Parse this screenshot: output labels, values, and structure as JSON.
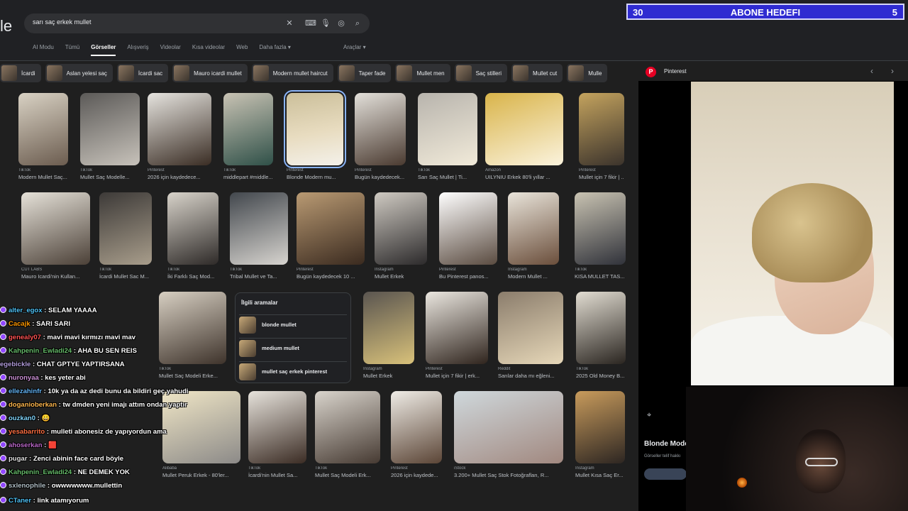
{
  "search": {
    "logo_fragment": "le",
    "query": "sarı saç erkek mullet",
    "tabs": [
      "AI Modu",
      "Tümü",
      "Görseller",
      "Alışveriş",
      "Videolar",
      "Kısa videolar",
      "Web",
      "Daha fazla ▾"
    ],
    "active_tab": "Görseller",
    "tools_label": "Araçlar ▾"
  },
  "goal": {
    "left": "30",
    "title": "ABONE HEDEFI",
    "right": "5"
  },
  "chips": [
    "İcardi",
    "Aslan yelesi saç",
    "İcardi sac",
    "Mauro icardi mullet",
    "Modern mullet haircut",
    "Taper fade",
    "Mullet men",
    "Saç stilleri",
    "Mullet cut",
    "Mulle"
  ],
  "grid": [
    {
      "src": "TikTok",
      "cap": "Modern Mullet Saç..."
    },
    {
      "src": "TikTok",
      "cap": "Mullet Saç Modelle..."
    },
    {
      "src": "Pinterest",
      "cap": "2026 için kaydedece..."
    },
    {
      "src": "TikTok",
      "cap": "middlepart #middle..."
    },
    {
      "src": "Pinterest",
      "cap": "Blonde Modern mu..."
    },
    {
      "src": "Pinterest",
      "cap": "Bugün kaydedecek..."
    },
    {
      "src": "TikTok",
      "cap": "Sarı Saç Mullet | Ti..."
    },
    {
      "src": "Amazon",
      "cap": "UILYNIU Erkek 80'li yıllar ..."
    },
    {
      "src": "Pinterest",
      "cap": "Mullet için 7 fikir | ..."
    },
    {
      "src": "CUT LABS",
      "cap": "Mauro Icardi'nin Kullan..."
    },
    {
      "src": "TikTok",
      "cap": "İcardi Mullet Sac M..."
    },
    {
      "src": "TikTok",
      "cap": "İki Farklı Saç Mod..."
    },
    {
      "src": "TikTok",
      "cap": "Tribal Mullet ve Ta..."
    },
    {
      "src": "Pinterest",
      "cap": "Bugün kaydedecek 10 ..."
    },
    {
      "src": "Instagram",
      "cap": "Mullet Erkek"
    },
    {
      "src": "Pinterest",
      "cap": "Bu Pinterest panos..."
    },
    {
      "src": "Instagram",
      "cap": "Modern Mullet ..."
    },
    {
      "src": "TikTok",
      "cap": "KISA MULLET TAS..."
    },
    {
      "src": "TikTok",
      "cap": "Mullet Saç Modeli Erke..."
    },
    {
      "src": "Instagram",
      "cap": "Mullet Erkek"
    },
    {
      "src": "Pinterest",
      "cap": "Mullet için 7 fikir | erk..."
    },
    {
      "src": "Reddit",
      "cap": "Sarılar daha mı eğleni..."
    },
    {
      "src": "TikTok",
      "cap": "2025 Old Money B..."
    },
    {
      "src": "Alibaba",
      "cap": "Mullet Peruk Erkek - 80'ler..."
    },
    {
      "src": "TikTok",
      "cap": "İcardi'nin Mullet Sa..."
    },
    {
      "src": "TikTok",
      "cap": "Mullet Saç Modeli Erk..."
    },
    {
      "src": "Pinterest",
      "cap": "2026 için kaydede..."
    },
    {
      "src": "iStock",
      "cap": "3.200+ Mullet Saç Stok Fotoğrafları, R..."
    },
    {
      "src": "Instagram",
      "cap": "Mullet Kısa Saç Er..."
    }
  ],
  "related": {
    "title": "İlgili aramalar",
    "items": [
      "blonde mullet",
      "medium mullet",
      "mullet saç erkek pinterest"
    ]
  },
  "panel": {
    "source": "Pinterest",
    "title": "Blonde Mode",
    "subtitle": "Görseller telif hakkı"
  },
  "chat": [
    {
      "user": "alter_egox",
      "text": "SELAM YAAAA",
      "color": "#4fc3f7"
    },
    {
      "user": "Cacajk",
      "text": "SARI SARI",
      "color": "#ff9800"
    },
    {
      "user": "genealy07",
      "text": "mavi mavi kırmızı mavi mav",
      "color": "#ff5252"
    },
    {
      "user": "Kahpenin_Ewladi24",
      "text": "AHA BU SEN REIS",
      "color": "#66bb6a"
    },
    {
      "user": "egebickle",
      "text": "CHAT GPTYE YAPTIRSANA",
      "color": "#b39ddb"
    },
    {
      "user": "nuronyaa",
      "text": "kes yeter abi",
      "color": "#ce93d8"
    },
    {
      "user": "ellezahinfr",
      "text": "10k ya da az dedi bunu da bildiri geç yahudi",
      "color": "#64b5f6"
    },
    {
      "user": "doganioberkan",
      "text": "tw dmden yeni imajı attım ondan yaptır",
      "color": "#ffb74d"
    },
    {
      "user": "ouzkan0",
      "text": "😀",
      "color": "#81d4fa"
    },
    {
      "user": "yesabarrito",
      "text": "mulleti abonesiz de yapıyordun ama",
      "color": "#ff7043"
    },
    {
      "user": "ahoserkan",
      "text": "🟥",
      "color": "#ba68c8"
    },
    {
      "user": "pugar",
      "text": "Zenci abinin face card böyle",
      "color": "#e0e0e0"
    },
    {
      "user": "Kahpenin_Ewladi24",
      "text": "NE DEMEK YOK",
      "color": "#66bb6a"
    },
    {
      "user": "sxlenophile",
      "text": "owwwwwww.mullettin",
      "color": "#b0bec5"
    },
    {
      "user": "CTaner",
      "text": "link atamıyorum",
      "color": "#4fc3f7"
    }
  ],
  "colors": {
    "page_bg": "#1f1f1f",
    "goal_bg": "#2f2bd1",
    "selected_outline": "#8ab4f8",
    "pinterest_red": "#e60023"
  }
}
